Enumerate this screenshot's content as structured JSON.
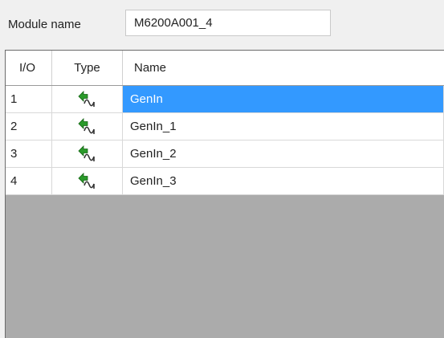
{
  "module": {
    "label": "Module name",
    "value": "M6200A001_4"
  },
  "table": {
    "columns": [
      "I/O",
      "Type",
      "Name"
    ],
    "rows": [
      {
        "io": "1",
        "type_icon": "generator-input-icon",
        "name": "GenIn",
        "selected": true
      },
      {
        "io": "2",
        "type_icon": "generator-input-icon",
        "name": "GenIn_1",
        "selected": false
      },
      {
        "io": "3",
        "type_icon": "generator-input-icon",
        "name": "GenIn_2",
        "selected": false
      },
      {
        "io": "4",
        "type_icon": "generator-input-icon",
        "name": "GenIn_3",
        "selected": false
      }
    ]
  },
  "colors": {
    "selection": "#3399ff",
    "empty_area": "#ababab",
    "icon_green": "#2a9a2a"
  }
}
